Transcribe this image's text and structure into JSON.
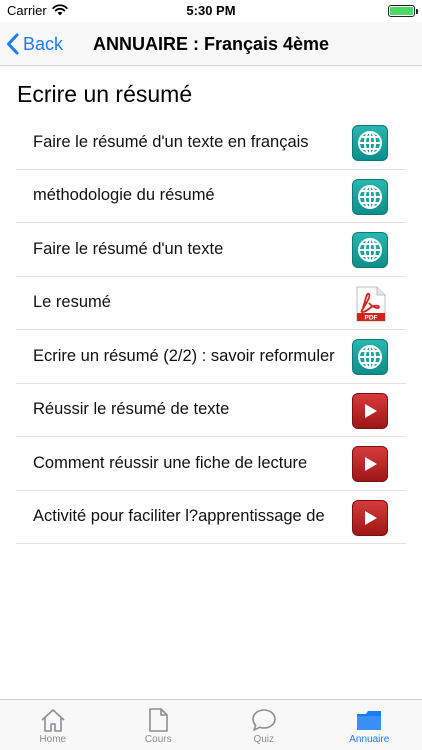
{
  "status_bar": {
    "carrier": "Carrier",
    "time": "5:30 PM"
  },
  "nav": {
    "back_label": "Back",
    "title": "ANNUAIRE : Français 4ème"
  },
  "section": {
    "title": "Ecrire un résumé"
  },
  "rows": [
    {
      "label": "Faire le résumé d'un texte en français",
      "icon": "globe-icon"
    },
    {
      "label": "méthodologie du résumé",
      "icon": "globe-icon"
    },
    {
      "label": "Faire le résumé d'un texte",
      "icon": "globe-icon"
    },
    {
      "label": "Le resumé",
      "icon": "pdf-icon",
      "icon_text": "PDF"
    },
    {
      "label": "Ecrire un résumé (2/2) : savoir reformuler",
      "icon": "globe-icon"
    },
    {
      "label": "Réussir le résumé de texte",
      "icon": "video-play-icon"
    },
    {
      "label": "Comment réussir une fiche de lecture",
      "icon": "video-play-icon"
    },
    {
      "label": "Activité pour faciliter l?apprentissage de",
      "icon": "video-play-icon"
    }
  ],
  "tabs": [
    {
      "label": "Home",
      "icon": "home-icon",
      "active": false
    },
    {
      "label": "Cours",
      "icon": "document-icon",
      "active": false
    },
    {
      "label": "Quiz",
      "icon": "chat-bubble-icon",
      "active": false
    },
    {
      "label": "Annuaire",
      "icon": "folder-icon",
      "active": true
    }
  ],
  "colors": {
    "accent": "#1a7cf5",
    "globe": "#15a09b",
    "video": "#b52222",
    "pdf": "#d3231f"
  }
}
